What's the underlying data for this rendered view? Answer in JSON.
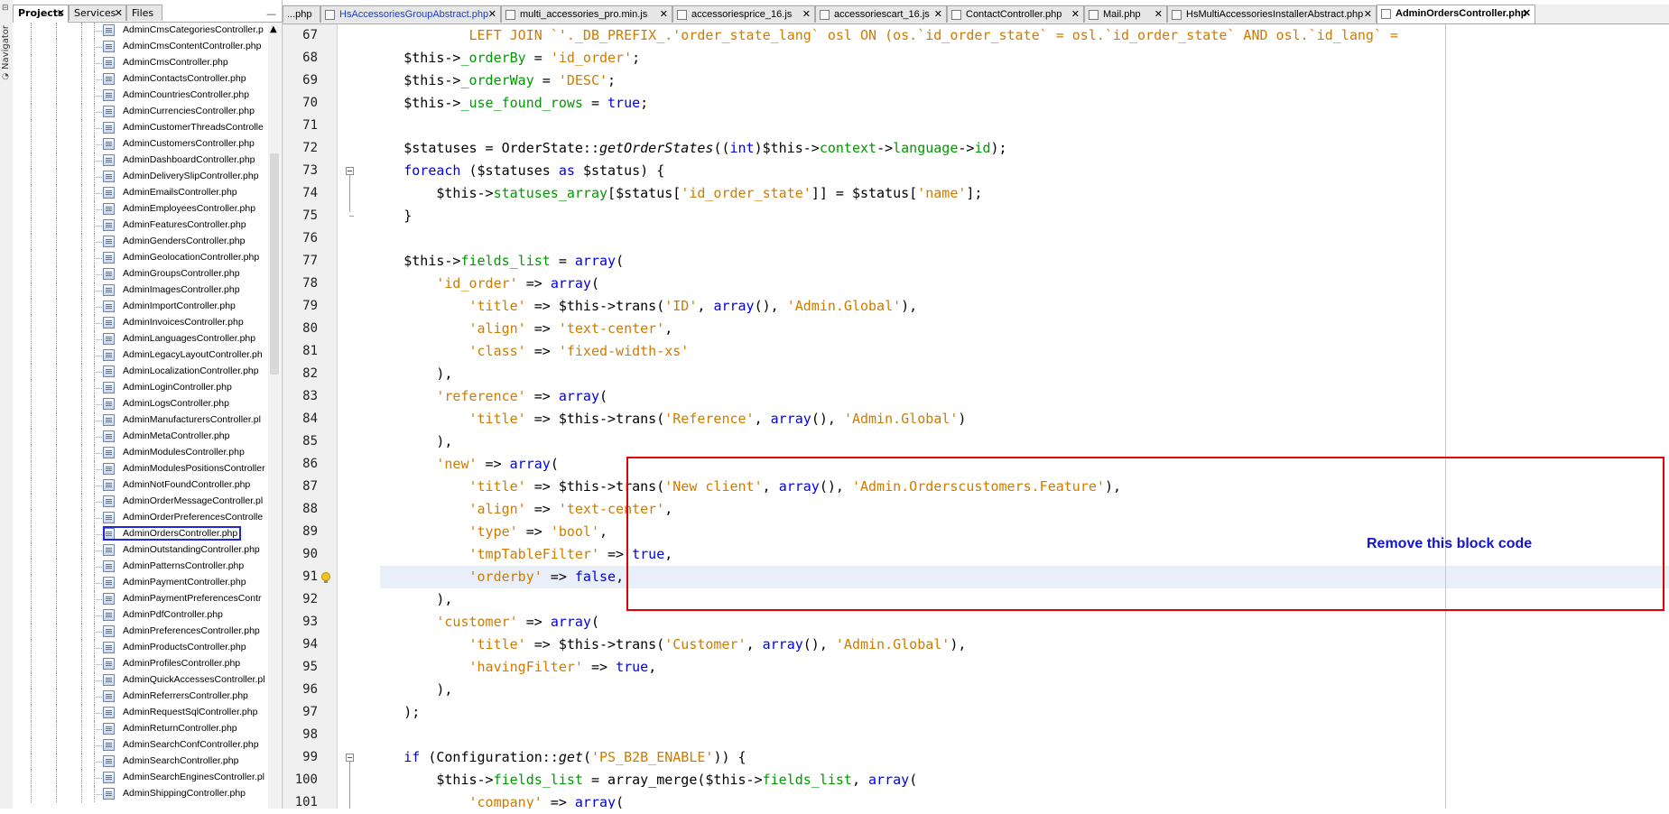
{
  "navigator": {
    "label": "Navigator"
  },
  "panel": {
    "tabs": [
      "Projects",
      "Services",
      "Files"
    ],
    "tree_items": [
      "AdminCmsCategoriesController.p",
      "AdminCmsContentController.php",
      "AdminCmsController.php",
      "AdminContactsController.php",
      "AdminCountriesController.php",
      "AdminCurrenciesController.php",
      "AdminCustomerThreadsControlle",
      "AdminCustomersController.php",
      "AdminDashboardController.php",
      "AdminDeliverySlipController.php",
      "AdminEmailsController.php",
      "AdminEmployeesController.php",
      "AdminFeaturesController.php",
      "AdminGendersController.php",
      "AdminGeolocationController.php",
      "AdminGroupsController.php",
      "AdminImagesController.php",
      "AdminImportController.php",
      "AdminInvoicesController.php",
      "AdminLanguagesController.php",
      "AdminLegacyLayoutController.ph",
      "AdminLocalizationController.php",
      "AdminLoginController.php",
      "AdminLogsController.php",
      "AdminManufacturersController.pl",
      "AdminMetaController.php",
      "AdminModulesController.php",
      "AdminModulesPositionsController",
      "AdminNotFoundController.php",
      "AdminOrderMessageController.pl",
      "AdminOrderPreferencesControlle",
      "AdminOrdersController.php",
      "AdminOutstandingController.php",
      "AdminPatternsController.php",
      "AdminPaymentController.php",
      "AdminPaymentPreferencesContr",
      "AdminPdfController.php",
      "AdminPreferencesController.php",
      "AdminProductsController.php",
      "AdminProfilesController.php",
      "AdminQuickAccessesController.pl",
      "AdminReferrersController.php",
      "AdminRequestSqlController.php",
      "AdminReturnController.php",
      "AdminSearchConfController.php",
      "AdminSearchController.php",
      "AdminSearchEnginesController.pl",
      "AdminShippingController.php"
    ],
    "selected_index": 31
  },
  "editor": {
    "tabs": [
      "...php",
      "HsAccessoriesGroupAbstract.php",
      "multi_accessories_pro.min.js",
      "accessoriesprice_16.js",
      "accessoriescart_16.js",
      "ContactController.php",
      "Mail.php",
      "HsMultiAccessoriesInstallerAbstract.php",
      "AdminOrdersController.php"
    ],
    "active_tab": "AdminOrdersController.php",
    "line_numbers": [
      "67",
      "68",
      "69",
      "70",
      "71",
      "72",
      "73",
      "74",
      "75",
      "76",
      "77",
      "78",
      "79",
      "80",
      "81",
      "82",
      "83",
      "84",
      "85",
      "86",
      "87",
      "88",
      "89",
      "90",
      "91",
      "92",
      "93",
      "94",
      "95",
      "96",
      "97",
      "98",
      "99",
      "100",
      "101"
    ]
  },
  "annotation": {
    "text": "Remove this block code",
    "color": "#1212d6",
    "box_color": "#e00000"
  },
  "colors": {
    "string": "#ce7b00",
    "property": "#009900",
    "keyword": "#0000e6",
    "highlight": "#e9eff8"
  }
}
